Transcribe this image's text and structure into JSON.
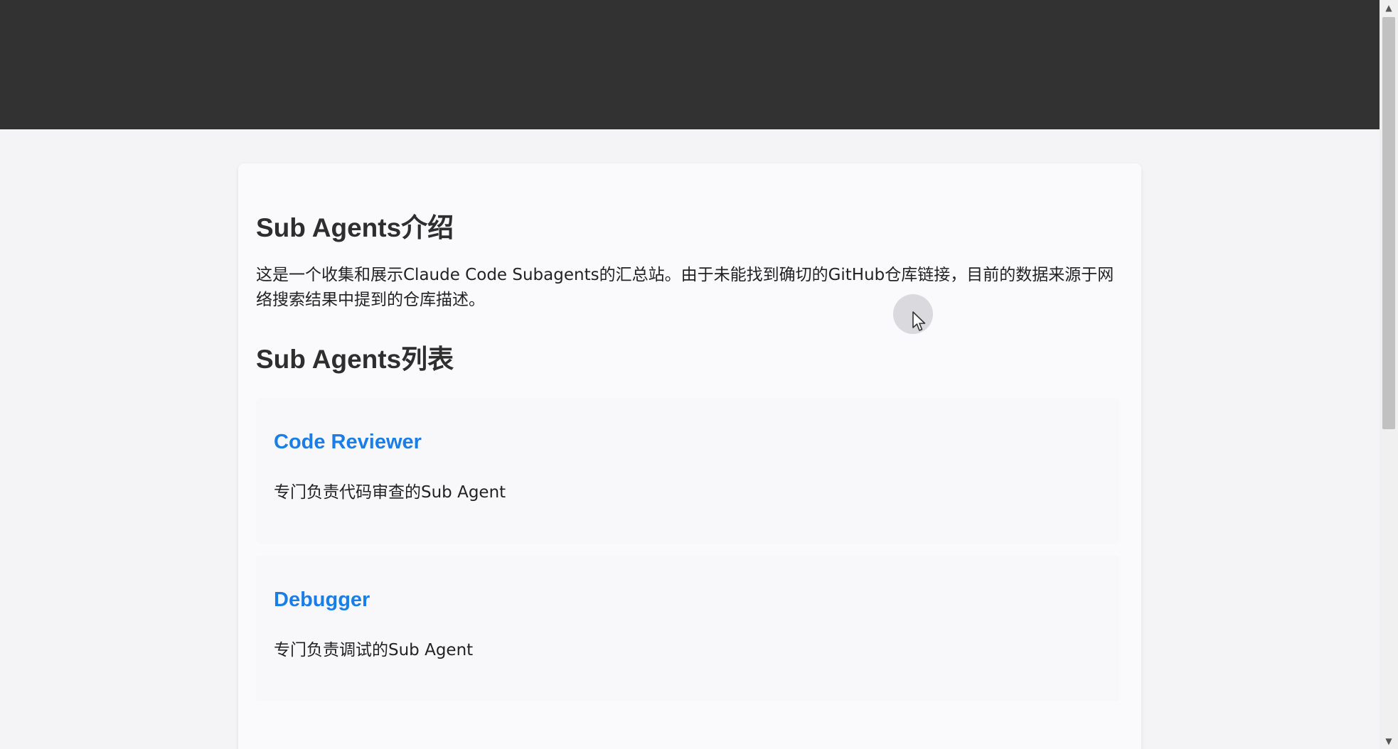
{
  "intro": {
    "title": "Sub Agents介绍",
    "text": "这是一个收集和展示Claude Code Subagents的汇总站。由于未能找到确切的GitHub仓库链接，目前的数据来源于网络搜索结果中提到的仓库描述。"
  },
  "list": {
    "title": "Sub Agents列表",
    "agents": [
      {
        "name": "Code Reviewer",
        "description": "专门负责代码审查的Sub Agent"
      },
      {
        "name": "Debugger",
        "description": "专门负责调试的Sub Agent"
      }
    ]
  },
  "scrollbar": {
    "up_glyph": "▲",
    "down_glyph": "▼"
  },
  "colors": {
    "banner": "#323232",
    "link": "#1a7ee6",
    "card": "#fafafc"
  }
}
